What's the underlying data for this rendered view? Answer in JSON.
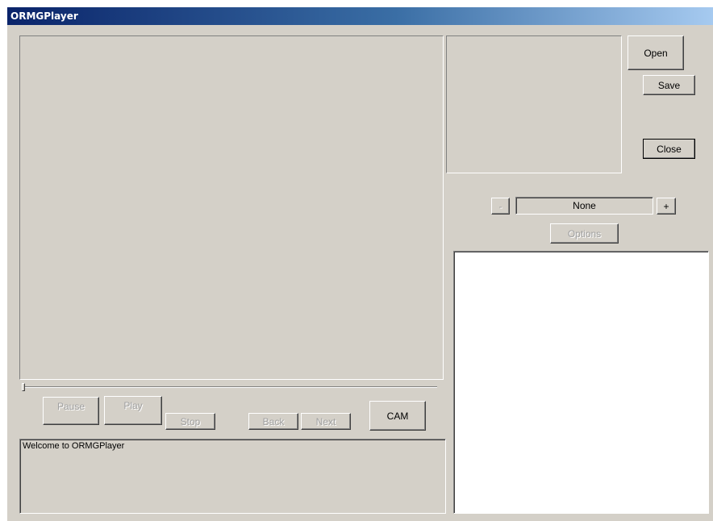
{
  "window": {
    "title": "ORMGPlayer"
  },
  "controls": {
    "open": "Open",
    "save": "Save",
    "close": "Close",
    "decrement": "-",
    "increment": "+",
    "selection": "None",
    "options": "Options"
  },
  "transport": {
    "pause": "Pause",
    "play": "Play",
    "stop": "Stop",
    "back": "Back",
    "next": "Next",
    "cam": "CAM",
    "seek_position": 0
  },
  "log": {
    "message": "Welcome to ORMGPlayer"
  }
}
